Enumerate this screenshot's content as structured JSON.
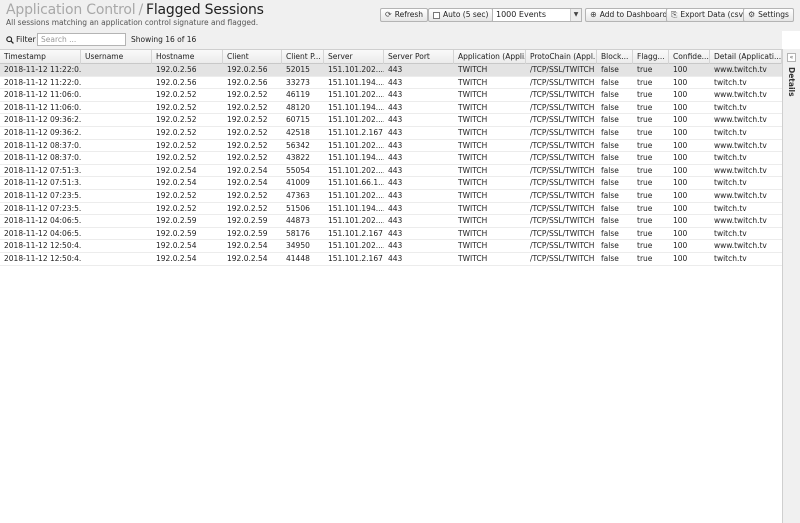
{
  "header": {
    "app_name": "Application Control",
    "separator": "/",
    "page_title": "Flagged Sessions",
    "subtitle": "All sessions matching an application control signature and flagged."
  },
  "toolbar": {
    "refresh_label": "Refresh",
    "auto_label": "Auto (5 sec)",
    "events_selected": "1000 Events",
    "add_dashboard_label": "Add to Dashboard",
    "export_label": "Export Data (csv)",
    "settings_label": "Settings"
  },
  "filter": {
    "label": "Filter",
    "placeholder": "Search ...",
    "showing": "Showing 16 of 16"
  },
  "details_panel": {
    "label": "Details"
  },
  "table": {
    "columns": [
      "Timestamp",
      "Username",
      "Hostname",
      "Client",
      "Client P...",
      "Server",
      "Server Port",
      "Application (Appli...",
      "ProtoChain (Appl...",
      "Block...",
      "Flagg...",
      "Confide...",
      "Detail (Applicati..."
    ],
    "rows": [
      [
        "2018-11-12 11:22:0...",
        "",
        "192.0.2.56",
        "192.0.2.56",
        "52015",
        "151.101.202....",
        "443",
        "TWITCH",
        "/TCP/SSL/TWITCH",
        "false",
        "true",
        "100",
        "www.twitch.tv"
      ],
      [
        "2018-11-12 11:22:0...",
        "",
        "192.0.2.56",
        "192.0.2.56",
        "33273",
        "151.101.194....",
        "443",
        "TWITCH",
        "/TCP/SSL/TWITCH",
        "false",
        "true",
        "100",
        "twitch.tv"
      ],
      [
        "2018-11-12 11:06:0...",
        "",
        "192.0.2.52",
        "192.0.2.52",
        "46119",
        "151.101.202....",
        "443",
        "TWITCH",
        "/TCP/SSL/TWITCH",
        "false",
        "true",
        "100",
        "www.twitch.tv"
      ],
      [
        "2018-11-12 11:06:0...",
        "",
        "192.0.2.52",
        "192.0.2.52",
        "48120",
        "151.101.194....",
        "443",
        "TWITCH",
        "/TCP/SSL/TWITCH",
        "false",
        "true",
        "100",
        "twitch.tv"
      ],
      [
        "2018-11-12 09:36:2...",
        "",
        "192.0.2.52",
        "192.0.2.52",
        "60715",
        "151.101.202....",
        "443",
        "TWITCH",
        "/TCP/SSL/TWITCH",
        "false",
        "true",
        "100",
        "www.twitch.tv"
      ],
      [
        "2018-11-12 09:36:2...",
        "",
        "192.0.2.52",
        "192.0.2.52",
        "42518",
        "151.101.2.167",
        "443",
        "TWITCH",
        "/TCP/SSL/TWITCH",
        "false",
        "true",
        "100",
        "twitch.tv"
      ],
      [
        "2018-11-12 08:37:0...",
        "",
        "192.0.2.52",
        "192.0.2.52",
        "56342",
        "151.101.202....",
        "443",
        "TWITCH",
        "/TCP/SSL/TWITCH",
        "false",
        "true",
        "100",
        "www.twitch.tv"
      ],
      [
        "2018-11-12 08:37:0...",
        "",
        "192.0.2.52",
        "192.0.2.52",
        "43822",
        "151.101.194....",
        "443",
        "TWITCH",
        "/TCP/SSL/TWITCH",
        "false",
        "true",
        "100",
        "twitch.tv"
      ],
      [
        "2018-11-12 07:51:3...",
        "",
        "192.0.2.54",
        "192.0.2.54",
        "55054",
        "151.101.202....",
        "443",
        "TWITCH",
        "/TCP/SSL/TWITCH",
        "false",
        "true",
        "100",
        "www.twitch.tv"
      ],
      [
        "2018-11-12 07:51:3...",
        "",
        "192.0.2.54",
        "192.0.2.54",
        "41009",
        "151.101.66.1....",
        "443",
        "TWITCH",
        "/TCP/SSL/TWITCH",
        "false",
        "true",
        "100",
        "twitch.tv"
      ],
      [
        "2018-11-12 07:23:5...",
        "",
        "192.0.2.52",
        "192.0.2.52",
        "47363",
        "151.101.202....",
        "443",
        "TWITCH",
        "/TCP/SSL/TWITCH",
        "false",
        "true",
        "100",
        "www.twitch.tv"
      ],
      [
        "2018-11-12 07:23:5...",
        "",
        "192.0.2.52",
        "192.0.2.52",
        "51506",
        "151.101.194....",
        "443",
        "TWITCH",
        "/TCP/SSL/TWITCH",
        "false",
        "true",
        "100",
        "twitch.tv"
      ],
      [
        "2018-11-12 04:06:5...",
        "",
        "192.0.2.59",
        "192.0.2.59",
        "44873",
        "151.101.202....",
        "443",
        "TWITCH",
        "/TCP/SSL/TWITCH",
        "false",
        "true",
        "100",
        "www.twitch.tv"
      ],
      [
        "2018-11-12 04:06:5...",
        "",
        "192.0.2.59",
        "192.0.2.59",
        "58176",
        "151.101.2.167",
        "443",
        "TWITCH",
        "/TCP/SSL/TWITCH",
        "false",
        "true",
        "100",
        "twitch.tv"
      ],
      [
        "2018-11-12 12:50:4...",
        "",
        "192.0.2.54",
        "192.0.2.54",
        "34950",
        "151.101.202....",
        "443",
        "TWITCH",
        "/TCP/SSL/TWITCH",
        "false",
        "true",
        "100",
        "www.twitch.tv"
      ],
      [
        "2018-11-12 12:50:4...",
        "",
        "192.0.2.54",
        "192.0.2.54",
        "41448",
        "151.101.2.167",
        "443",
        "TWITCH",
        "/TCP/SSL/TWITCH",
        "false",
        "true",
        "100",
        "twitch.tv"
      ]
    ]
  }
}
